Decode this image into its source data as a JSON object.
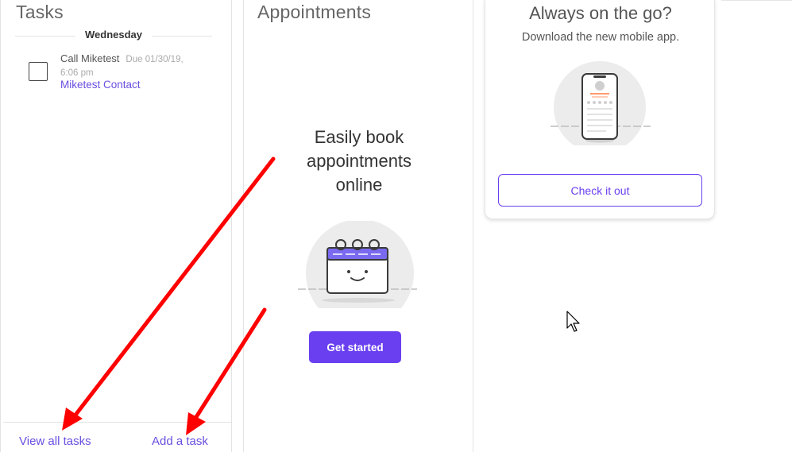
{
  "tasks": {
    "title": "Tasks",
    "day_label": "Wednesday",
    "items": [
      {
        "title": "Call Miketest",
        "due": "Due 01/30/19,",
        "due_time": "6:06 pm",
        "contact": "Miketest Contact"
      }
    ],
    "footer": {
      "view_all": "View all tasks",
      "add": "Add a task"
    }
  },
  "appointments": {
    "title": "Appointments",
    "headline_lines": [
      "Easily book",
      "appointments",
      "online"
    ],
    "cta": "Get started"
  },
  "mobile": {
    "title": "Always on the go?",
    "subtitle": "Download the new mobile app.",
    "cta": "Check it out"
  },
  "colors": {
    "accent": "#6a3ff0",
    "link": "#6a4fe0",
    "annotation_arrow": "#ff0000"
  },
  "icons": [
    "calendar-illustration-icon",
    "phone-illustration-icon",
    "mouse-cursor-icon",
    "annotation-arrow-icon"
  ]
}
